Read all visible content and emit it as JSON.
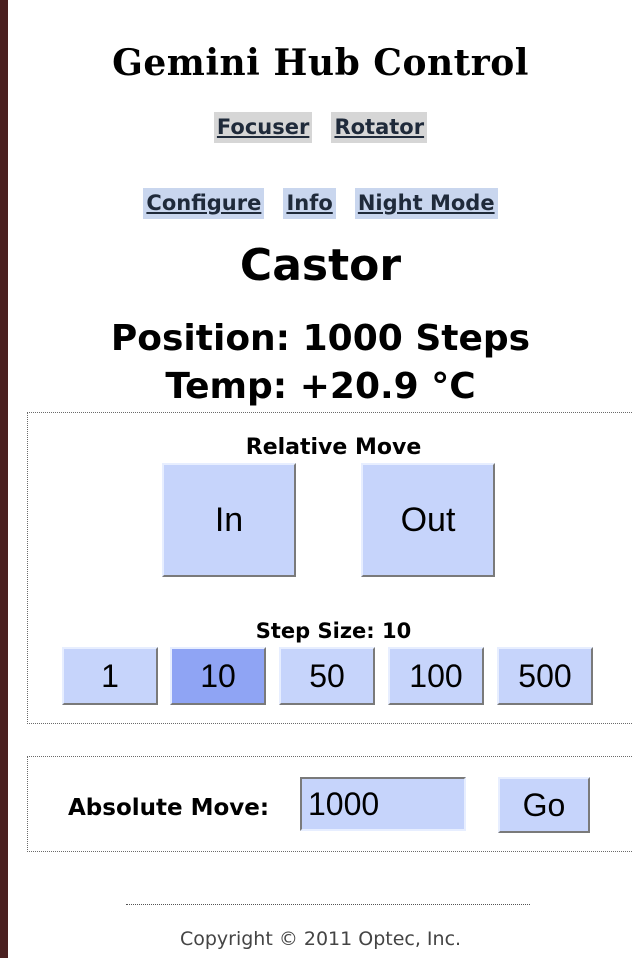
{
  "app": {
    "title": "Gemini Hub Control"
  },
  "nav_primary": [
    {
      "label": "Focuser"
    },
    {
      "label": "Rotator"
    }
  ],
  "nav_secondary": [
    {
      "label": "Configure"
    },
    {
      "label": "Info"
    },
    {
      "label": "Night Mode"
    }
  ],
  "device": {
    "name": "Castor"
  },
  "status": {
    "position": "Position: 1000 Steps",
    "temp": "Temp: +20.9 °C"
  },
  "relative_move": {
    "label": "Relative Move",
    "in_label": "In",
    "out_label": "Out",
    "step_size_label": "Step Size: 10",
    "step_sizes": [
      "1",
      "10",
      "50",
      "100",
      "500"
    ],
    "selected_step": "10"
  },
  "absolute_move": {
    "label": "Absolute Move:",
    "value": "1000",
    "go_label": "Go"
  },
  "footer": {
    "copyright": "Copyright © 2011 Optec, Inc."
  },
  "colors": {
    "button": "#c6d4fb",
    "button_active": "#8fa4f4",
    "nav_primary_bg": "#d6d6d6",
    "nav_secondary_bg": "#c9d6ee",
    "left_bar": "#4a2020"
  }
}
